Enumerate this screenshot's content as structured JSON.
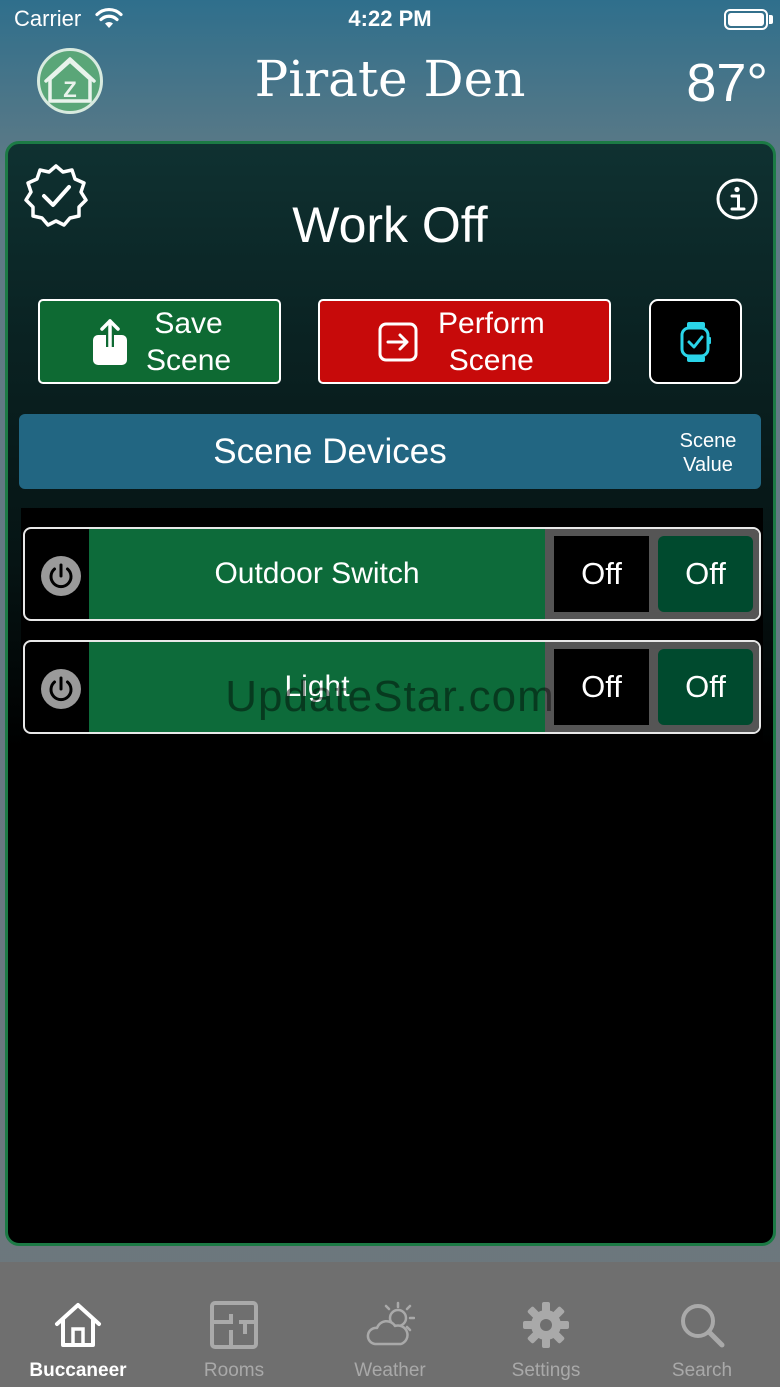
{
  "status_bar": {
    "carrier": "Carrier",
    "time": "4:22 PM"
  },
  "header": {
    "title": "Pirate Den",
    "temperature": "87°",
    "logo_letter": "Z"
  },
  "scene": {
    "title": "Work Off",
    "save_label": "Save\nScene",
    "perform_label": "Perform\nScene"
  },
  "devices": {
    "header_title": "Scene Devices",
    "value_label": "Scene\nValue",
    "items": [
      {
        "name": "Outdoor Switch",
        "current_state": "Off",
        "scene_state": "Off"
      },
      {
        "name": "Light",
        "current_state": "Off",
        "scene_state": "Off"
      }
    ]
  },
  "watermark": "UpdateStar.com",
  "tabs": [
    {
      "label": "Buccaneer",
      "icon": "home-icon",
      "active": true
    },
    {
      "label": "Rooms",
      "icon": "floorplan-icon",
      "active": false
    },
    {
      "label": "Weather",
      "icon": "weather-icon",
      "active": false
    },
    {
      "label": "Settings",
      "icon": "gear-icon",
      "active": false
    },
    {
      "label": "Search",
      "icon": "search-icon",
      "active": false
    }
  ],
  "colors": {
    "accent_green": "#0e6a33",
    "perform_red": "#c70a0a",
    "devices_header": "#226682",
    "watch_icon": "#2ad4e8"
  }
}
